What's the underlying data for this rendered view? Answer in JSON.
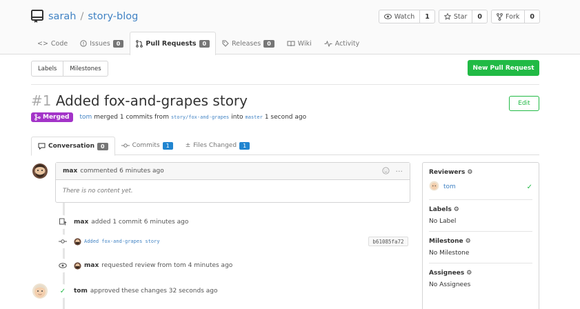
{
  "repo": {
    "owner": "sarah",
    "separator": "/",
    "name": "story-blog"
  },
  "header_buttons": {
    "watch": {
      "label": "Watch",
      "count": "1"
    },
    "star": {
      "label": "Star",
      "count": "0"
    },
    "fork": {
      "label": "Fork",
      "count": "0"
    }
  },
  "nav_tabs": [
    {
      "label": "Code"
    },
    {
      "label": "Issues",
      "count": "0"
    },
    {
      "label": "Pull Requests",
      "count": "0"
    },
    {
      "label": "Releases",
      "count": "0"
    },
    {
      "label": "Wiki"
    },
    {
      "label": "Activity"
    }
  ],
  "filters": {
    "labels": "Labels",
    "milestones": "Milestones"
  },
  "new_pr_button": "New Pull Request",
  "pr": {
    "number": "#1",
    "title": "Added fox-and-grapes story",
    "edit": "Edit",
    "status": "Merged",
    "meta": {
      "user": "tom",
      "merged_text": "merged 1 commits from",
      "head_branch": "story/fox-and-grapes",
      "into": "into",
      "base_branch": "master",
      "time": "1 second ago"
    }
  },
  "content_tabs": [
    {
      "label": "Conversation",
      "count": "0"
    },
    {
      "label": "Commits",
      "count": "1"
    },
    {
      "label": "Files Changed",
      "count": "1"
    }
  ],
  "comment": {
    "author": "max",
    "meta": "commented 6 minutes ago",
    "body": "There is no content yet."
  },
  "timeline": {
    "added_commit": {
      "user": "max",
      "text": "added 1 commit 6 minutes ago"
    },
    "commit": {
      "message": "Added fox-and-grapes story",
      "sha": "b61085fa72"
    },
    "review_request": {
      "user": "max",
      "text": "requested review from tom 4 minutes ago"
    },
    "approval": {
      "user": "tom",
      "text": "approved these changes 32 seconds ago"
    }
  },
  "sidebar": {
    "reviewers": {
      "title": "Reviewers",
      "name": "tom"
    },
    "labels": {
      "title": "Labels",
      "value": "No Label"
    },
    "milestone": {
      "title": "Milestone",
      "value": "No Milestone"
    },
    "assignees": {
      "title": "Assignees",
      "value": "No Assignees"
    }
  },
  "colors": {
    "accent": "#4183c4",
    "success": "#21ba45",
    "merged": "#a333c8",
    "badge_blue": "#2185d0"
  },
  "icons": [
    "repo-icon",
    "eye-icon",
    "star-icon",
    "fork-icon",
    "code-icon",
    "issue-icon",
    "pull-request-icon",
    "tag-icon",
    "book-icon",
    "pulse-icon",
    "merge-icon",
    "comment-icon",
    "commit-icon",
    "plus-minus-icon",
    "emoji-icon",
    "more-icon",
    "push-icon",
    "check-icon",
    "gear-icon"
  ]
}
